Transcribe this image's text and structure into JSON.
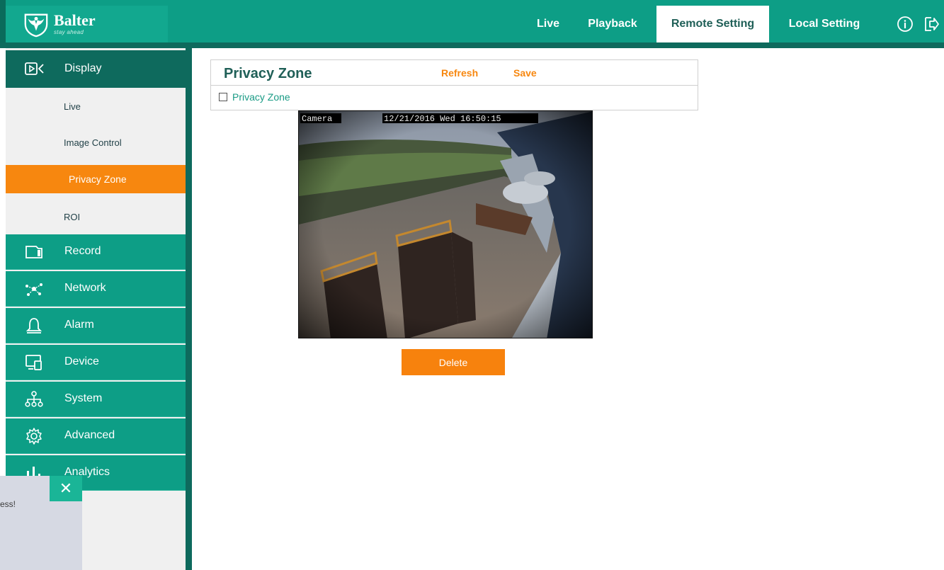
{
  "header": {
    "logo_name": "Balter",
    "logo_tagline": "stay ahead",
    "nav": [
      {
        "label": "Live"
      },
      {
        "label": "Playback"
      },
      {
        "label": "Remote Setting",
        "active": true
      },
      {
        "label": "Local Setting"
      }
    ],
    "icons": [
      "info-icon",
      "logout-icon"
    ]
  },
  "sidebar": {
    "section": {
      "label": "Display",
      "icon": "display-icon"
    },
    "subitems": [
      {
        "label": "Live"
      },
      {
        "label": "Image Control"
      },
      {
        "label": "Privacy Zone",
        "active": true
      },
      {
        "label": "ROI"
      }
    ],
    "items": [
      {
        "label": "Record",
        "icon": "record-icon"
      },
      {
        "label": "Network",
        "icon": "network-icon"
      },
      {
        "label": "Alarm",
        "icon": "alarm-bell-icon"
      },
      {
        "label": "Device",
        "icon": "device-icon"
      },
      {
        "label": "System",
        "icon": "system-tree-icon"
      },
      {
        "label": "Advanced",
        "icon": "gear-icon"
      },
      {
        "label": "Analytics",
        "icon": "analytics-icon"
      }
    ]
  },
  "toast": {
    "text": "ess!",
    "close_icon": "close-icon"
  },
  "content": {
    "title": "Privacy Zone",
    "refresh_label": "Refresh",
    "save_label": "Save",
    "checkbox_label": "Privacy Zone",
    "checkbox_checked": false,
    "video": {
      "channel_label": "Camera",
      "timestamp": "12/21/2016 Wed 16:50:15"
    },
    "delete_label": "Delete"
  },
  "colors": {
    "teal": "#0d9e86",
    "dark_teal": "#0e6a5d",
    "orange": "#f7870f",
    "title_green": "#1f5f57"
  }
}
